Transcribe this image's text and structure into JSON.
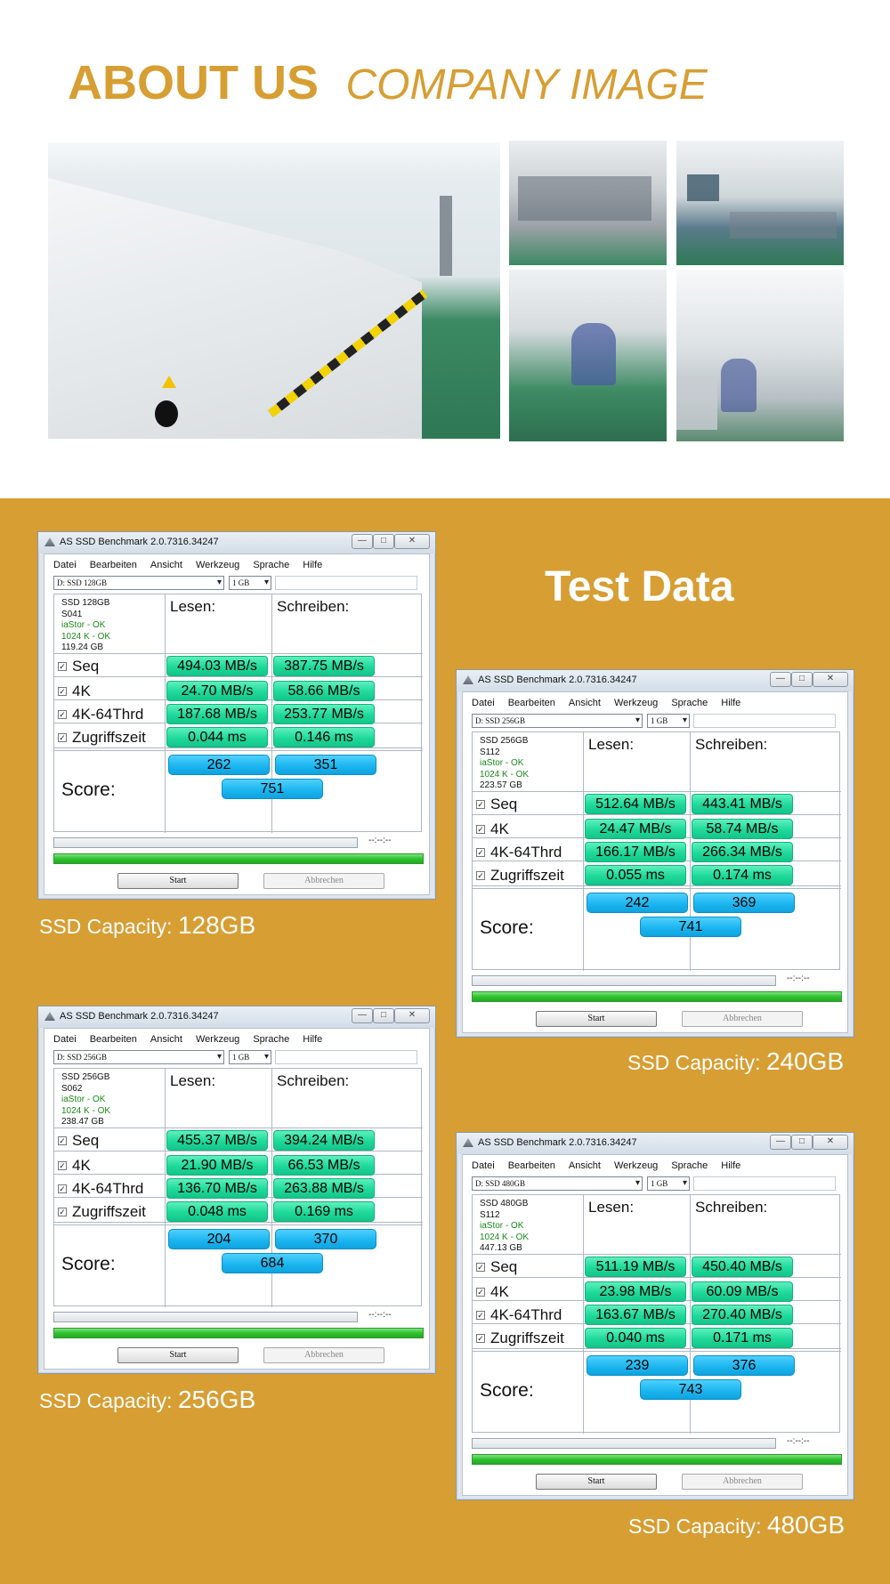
{
  "about": {
    "title_main": "ABOUT US",
    "title_sub": "COMPANY IMAGE"
  },
  "test": {
    "title": "Test Data"
  },
  "window_template": {
    "title": "AS SSD Benchmark 2.0.7316.34247",
    "menu": [
      "Datei",
      "Bearbeiten",
      "Ansicht",
      "Werkzeug",
      "Sprache",
      "Hilfe"
    ],
    "size_select": "1 GB",
    "col_read": "Lesen:",
    "col_write": "Schreiben:",
    "rows": [
      "Seq",
      "4K",
      "4K-64Thrd",
      "Zugriffszeit"
    ],
    "score_label": "Score:",
    "timer": "--:--:--",
    "start": "Start",
    "abort": "Abbrechen",
    "iastor": "iaStor - OK",
    "align": "1024 K - OK"
  },
  "benchmarks": [
    {
      "drive_select": "D: SSD 128GB",
      "device": "SSD 128GB",
      "firmware": "S041",
      "capacity_detail": "119.24 GB",
      "read": [
        "494.03 MB/s",
        "24.70 MB/s",
        "187.68 MB/s",
        "0.044 ms"
      ],
      "write": [
        "387.75 MB/s",
        "58.66 MB/s",
        "253.77 MB/s",
        "0.146 ms"
      ],
      "score_read": "262",
      "score_write": "351",
      "score_total": "751",
      "caption_label": "SSD Capacity: ",
      "caption_value": "128GB"
    },
    {
      "drive_select": "D: SSD 256GB",
      "device": "SSD 256GB",
      "firmware": "S112",
      "capacity_detail": "223.57 GB",
      "read": [
        "512.64 MB/s",
        "24.47 MB/s",
        "166.17 MB/s",
        "0.055 ms"
      ],
      "write": [
        "443.41 MB/s",
        "58.74 MB/s",
        "266.34 MB/s",
        "0.174 ms"
      ],
      "score_read": "242",
      "score_write": "369",
      "score_total": "741",
      "caption_label": "SSD Capacity: ",
      "caption_value": "240GB"
    },
    {
      "drive_select": "D: SSD 256GB",
      "device": "SSD 256GB",
      "firmware": "S062",
      "capacity_detail": "238.47 GB",
      "read": [
        "455.37 MB/s",
        "21.90 MB/s",
        "136.70 MB/s",
        "0.048 ms"
      ],
      "write": [
        "394.24 MB/s",
        "66.53 MB/s",
        "263.88 MB/s",
        "0.169 ms"
      ],
      "score_read": "204",
      "score_write": "370",
      "score_total": "684",
      "caption_label": "SSD Capacity: ",
      "caption_value": "256GB"
    },
    {
      "drive_select": "D: SSD 480GB",
      "device": "SSD 480GB",
      "firmware": "S112",
      "capacity_detail": "447.13 GB",
      "read": [
        "511.19 MB/s",
        "23.98 MB/s",
        "163.67 MB/s",
        "0.040 ms"
      ],
      "write": [
        "450.40 MB/s",
        "60.09 MB/s",
        "270.40 MB/s",
        "0.171 ms"
      ],
      "score_read": "239",
      "score_write": "376",
      "score_total": "743",
      "caption_label": "SSD Capacity: ",
      "caption_value": "480GB"
    }
  ],
  "colors": {
    "gold": "#D79E33",
    "value_green": "#1ED99A",
    "score_blue": "#1DB6EF",
    "progress_green": "#2FC22F"
  }
}
